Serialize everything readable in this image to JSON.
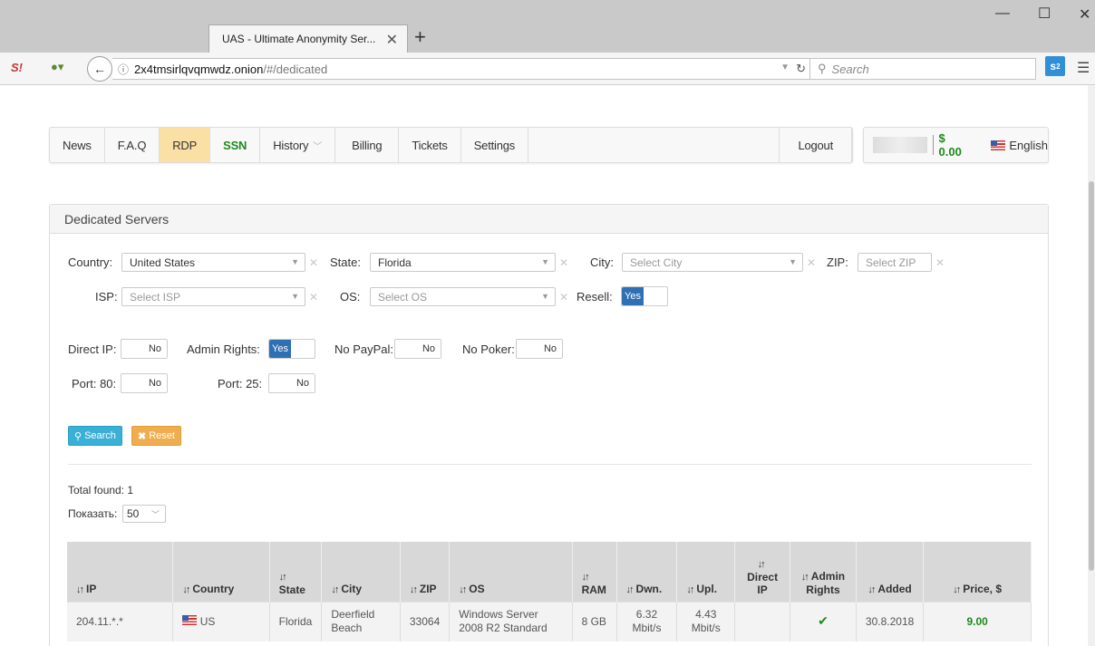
{
  "browser": {
    "tab_title": "UAS - Ultimate Anonymity Ser...",
    "url_host": "2x4tmsirlqvqmwdz.onion",
    "url_path": "/#/dedicated",
    "search_placeholder": "Search",
    "ext_badge": "2"
  },
  "nav": {
    "items": [
      "News",
      "F.A.Q",
      "RDP",
      "SSN",
      "History",
      "Billing",
      "Tickets",
      "Settings"
    ],
    "logout": "Logout",
    "balance": "$ 0.00",
    "language": "English"
  },
  "panel": {
    "title": "Dedicated Servers",
    "filters": {
      "country_label": "Country:",
      "country_value": "United States",
      "state_label": "State:",
      "state_value": "Florida",
      "city_label": "City:",
      "city_placeholder": "Select City",
      "zip_label": "ZIP:",
      "zip_placeholder": "Select ZIP",
      "isp_label": "ISP:",
      "isp_placeholder": "Select ISP",
      "os_label": "OS:",
      "os_placeholder": "Select OS",
      "resell_label": "Resell:"
    },
    "toggles": {
      "direct_ip": "Direct IP:",
      "admin_rights": "Admin Rights:",
      "no_paypal": "No PayPal:",
      "no_poker": "No Poker:",
      "port80": "Port: 80:",
      "port25": "Port: 25:",
      "yes": "Yes",
      "no": "No"
    },
    "search_btn": "Search",
    "reset_btn": "Reset",
    "total_found": "Total found: 1",
    "show_label": "Показать:",
    "show_value": "50"
  },
  "table": {
    "headers": {
      "ip": "IP",
      "country": "Country",
      "state": "State",
      "city": "City",
      "zip": "ZIP",
      "os": "OS",
      "ram": "RAM",
      "dwn": "Dwn.",
      "upl": "Upl.",
      "direct_ip_1": "Direct",
      "direct_ip_2": "IP",
      "admin_1": "Admin",
      "admin_2": "Rights",
      "added": "Added",
      "price": "Price, $"
    },
    "row": {
      "ip": "204.11.*.*",
      "country": "US",
      "state": "Florida",
      "city_1": "Deerfield",
      "city_2": "Beach",
      "zip": "33064",
      "os_1": "Windows Server",
      "os_2": "2008 R2 Standard",
      "ram": "8 GB",
      "dwn_1": "6.32",
      "dwn_2": "Mbit/s",
      "upl_1": "4.43",
      "upl_2": "Mbit/s",
      "added": "30.8.2018",
      "price": "9.00"
    }
  }
}
